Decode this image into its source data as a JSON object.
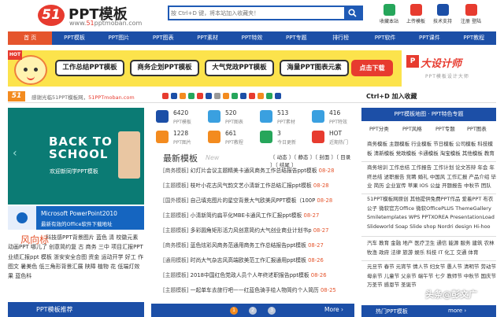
{
  "header": {
    "logo_mark": "51",
    "site_title": "PPT模板",
    "site_url_prefix": "www.",
    "site_url_highlight": "51",
    "site_url_suffix": "pptmoban.com",
    "search_placeholder": "按 Ctrl+D 键，将本站加入收藏夹！",
    "quick_links": [
      {
        "label": "收藏本站",
        "color": "#26a65b"
      },
      {
        "label": "上传模板",
        "color": "#e73b2f"
      },
      {
        "label": "技术支持",
        "color": "#1c4fa7"
      },
      {
        "label": "注册 登陆",
        "color": "#e73b2f"
      }
    ]
  },
  "nav": {
    "items": [
      "首 页",
      "PPT模板",
      "PPT图片",
      "PPT图表",
      "PPT素材",
      "PPT特效",
      "PPT专题",
      "排行榜",
      "PPT软件",
      "PPT课件",
      "PPT教程"
    ],
    "active_index": 0
  },
  "banner": {
    "hot": "HOT",
    "buttons": [
      "工作总结PPT模板",
      "商务企划PPT模板",
      "大气党政PPT模板",
      "海量PPT图表元素"
    ],
    "download": "点击下载",
    "right_mark": "P",
    "right_title": "大设计师",
    "right_sub": "PPT模板设计大师"
  },
  "welcome": {
    "logo": "51",
    "text_prefix": "感谢光临51PPT模板网，",
    "text_url": "51PPTmoban.com",
    "share_colors": [
      "#e73b2f",
      "#1c4fa7",
      "#f38b1f",
      "#26a65b",
      "#e73b2f",
      "#1c4fa7",
      "#999",
      "#f38b1f",
      "#26a65b",
      "#1c4fa7",
      "#e73b2f",
      "#f38b1f",
      "#26a65b",
      "#1c4fa7"
    ],
    "ctrl_text": "Ctrl+D 加入收藏"
  },
  "slider": {
    "line1": "BACK TO",
    "line2": "SCHOOL",
    "caption": "欢迎新同学PPT模板",
    "prev": "‹",
    "next": "›"
  },
  "promo": {
    "title": "Microsoft PowerPoint2010",
    "subtitle": "最新有效的Office软件下载地址"
  },
  "keywords": {
    "title": "风向标",
    "list": "科技感PPT背景图片 蓝色 清 校徽元素 动画PPT 哪儿了 创意简约复 古 商务 三中 项目汇报PPT 业绩汇报ppt 模板 浙安安全合图 资金 运动开学 好工 作 图文 暑美色 低三角形背景汇展 陕障 植物 花 低端灯效果 蓝色科"
  },
  "left_footer": {
    "title": "PPT模板推荐"
  },
  "stats": [
    {
      "num": "6420",
      "label": "PPT模板",
      "color": "#1c4fa7"
    },
    {
      "num": "520",
      "label": "PPT图表",
      "color": "#3aa0e0"
    },
    {
      "num": "513",
      "label": "PPT素材",
      "color": "#3aa0e0"
    },
    {
      "num": "416",
      "label": "PPT特效",
      "color": "#3aa0e0"
    },
    {
      "num": "1228",
      "label": "PPT图片",
      "color": "#f38b1f"
    },
    {
      "num": "661",
      "label": "PPT教程",
      "color": "#f38b1f"
    },
    {
      "num": "3",
      "label": "今日更新",
      "color": "#26a65b"
    },
    {
      "num": "HOT",
      "label": "近期热门",
      "color": "#e73b2f"
    }
  ],
  "latest": {
    "title": "最新模板",
    "title_en": "New",
    "tabs": "〔 动态 〕〔 静态 〕〔 封面 〕〔 目录 〕〔 结尾 〕",
    "rows": [
      {
        "cat": "[商务模板]",
        "title": "幻灯片会议主题精美卡通风商务工作总结报告ppt模板",
        "date": "08-28"
      },
      {
        "cat": "[主题模板]",
        "title": "枝叶小花古风气韵文艺小清新工作总结汇报ppt模板",
        "date": "08-28"
      },
      {
        "cat": "[国外模板]",
        "title": "自己填充图片的星空背景大气欧美风PPT模板（100P",
        "date": "08-28"
      },
      {
        "cat": "[主题模板]",
        "title": "小清新简约扁平化MBE卡通风工作汇报ppt模板",
        "date": "08-27"
      },
      {
        "cat": "[主题模板]",
        "title": "多彩圆角矩形活力风创意简约大气创业商业计划书p",
        "date": "08-27"
      },
      {
        "cat": "[商务模板]",
        "title": "蓝色炫彩风商务范通用商务工作总结报告ppt模板",
        "date": "08-27"
      },
      {
        "cat": "[通用模板]",
        "title": "时尚大气杂志风高端欧美范工作汇报通用ppt模板",
        "date": "08-26"
      },
      {
        "cat": "[主题模板]",
        "title": "2018中国红色党政人员个人年终述职报告ppt模板",
        "date": "08-26"
      },
      {
        "cat": "[主题模板]",
        "title": "一起单车去旅行吧——红蓝色骑手绘人物简约个人简历",
        "date": "08-25"
      }
    ]
  },
  "pager": {
    "pages": [
      "1",
      "2",
      "3"
    ],
    "more": "More ›"
  },
  "right": {
    "header": "PPT模板地图 · PPT特色专题",
    "tabs": [
      "PPT分类",
      "PPT风格",
      "PPT专题",
      "PPT图表"
    ],
    "block1": "商务模板  主题模板  行业模板  节日模板  公司模板  科技模板  清新模板  党政模板  卡通模板  淘宝模板  其他模板  教育模板",
    "block2": "商务培训  工作总结  工作报告  工作计划  论文答辩  年会  年终总结  述职报告  竞聘  婚礼  中国风  工作汇报  产品介绍  毕业  简历  企业宣传  苹果  IOS  公益  开题报告  中秋节  团队  招聘  毕业  教师  学生",
    "block3": "51PPT模板网原创  其他提供免费PPT作品  爱着PPT  布衣公子  微软官方Office  微软OfficePLUS  ThemeGallery  Smiletemplates  WPS  PPTXOREA  PresentationLoad  Slideworld  Soap  Slide shop  Nordri design  Hi-hoo PPT",
    "block4": "汽车  教育  金融  地产  医疗卫生  通信  能源  服务  建筑  农林牧渔  政府  法律  旅游  娱乐  科技  IT  化工  交通  体育",
    "block5": "元旦节  春节  元宵节  情人节  妇女节  愚人节  清明节  劳动节  母亲节  儿童节  父亲节  端午节  七夕  教师节  中秋节  国庆节  万圣节  感恩节  圣诞节",
    "footer_title": "热门PPT模板",
    "footer_more": "more ›"
  },
  "watermark": "头条@彭文广"
}
